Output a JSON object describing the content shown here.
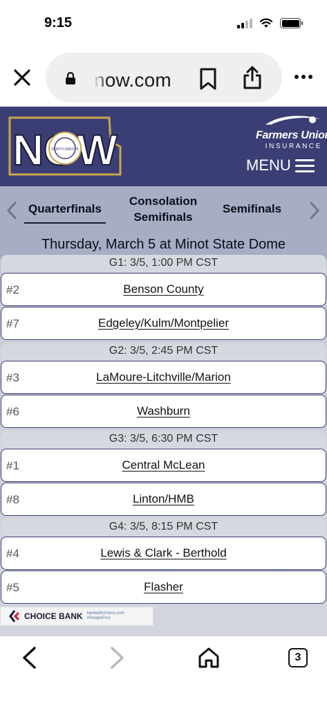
{
  "status_bar": {
    "time": "9:15"
  },
  "browser": {
    "url": "now.com",
    "open_tabs": "3"
  },
  "header": {
    "logo_text": "NOW",
    "logo_ring_text": "NORTH DAKOTA",
    "sponsor_name": "Farmers Union",
    "sponsor_sub": "INSURANCE",
    "menu_label": "MENU"
  },
  "rounds": [
    {
      "label": "Quarterfinals",
      "active": true
    },
    {
      "label": "Consolation Semifinals",
      "active": false
    },
    {
      "label": "Semifinals",
      "active": false
    }
  ],
  "schedule": {
    "date_heading": "Thursday, March 5 at Minot State Dome",
    "games": [
      {
        "header": "G1: 3/5, 1:00 PM CST",
        "teams": [
          {
            "seed": "#2",
            "name": "Benson County"
          },
          {
            "seed": "#7",
            "name": "Edgeley/Kulm/Montpelier"
          }
        ]
      },
      {
        "header": "G2: 3/5, 2:45 PM CST",
        "teams": [
          {
            "seed": "#3",
            "name": "LaMoure-Litchville/Marion"
          },
          {
            "seed": "#6",
            "name": "Washburn"
          }
        ]
      },
      {
        "header": "G3: 3/5, 6:30 PM CST",
        "teams": [
          {
            "seed": "#1",
            "name": "Central McLean"
          },
          {
            "seed": "#8",
            "name": "Linton/HMB"
          }
        ]
      },
      {
        "header": "G4: 3/5, 8:15 PM CST",
        "teams": [
          {
            "seed": "#4",
            "name": "Lewis & Clark - Berthold"
          },
          {
            "seed": "#5",
            "name": "Flasher"
          }
        ]
      }
    ]
  },
  "sponsor_banner": {
    "name": "CHOICE BANK",
    "tagline": "bankwithchoice.com #PeopleFirst"
  },
  "colors": {
    "header_bg": "#3a3e74",
    "nav_bg": "#a7aec4",
    "row_border": "#3a3e74",
    "logo_gold": "#c9a84a"
  }
}
